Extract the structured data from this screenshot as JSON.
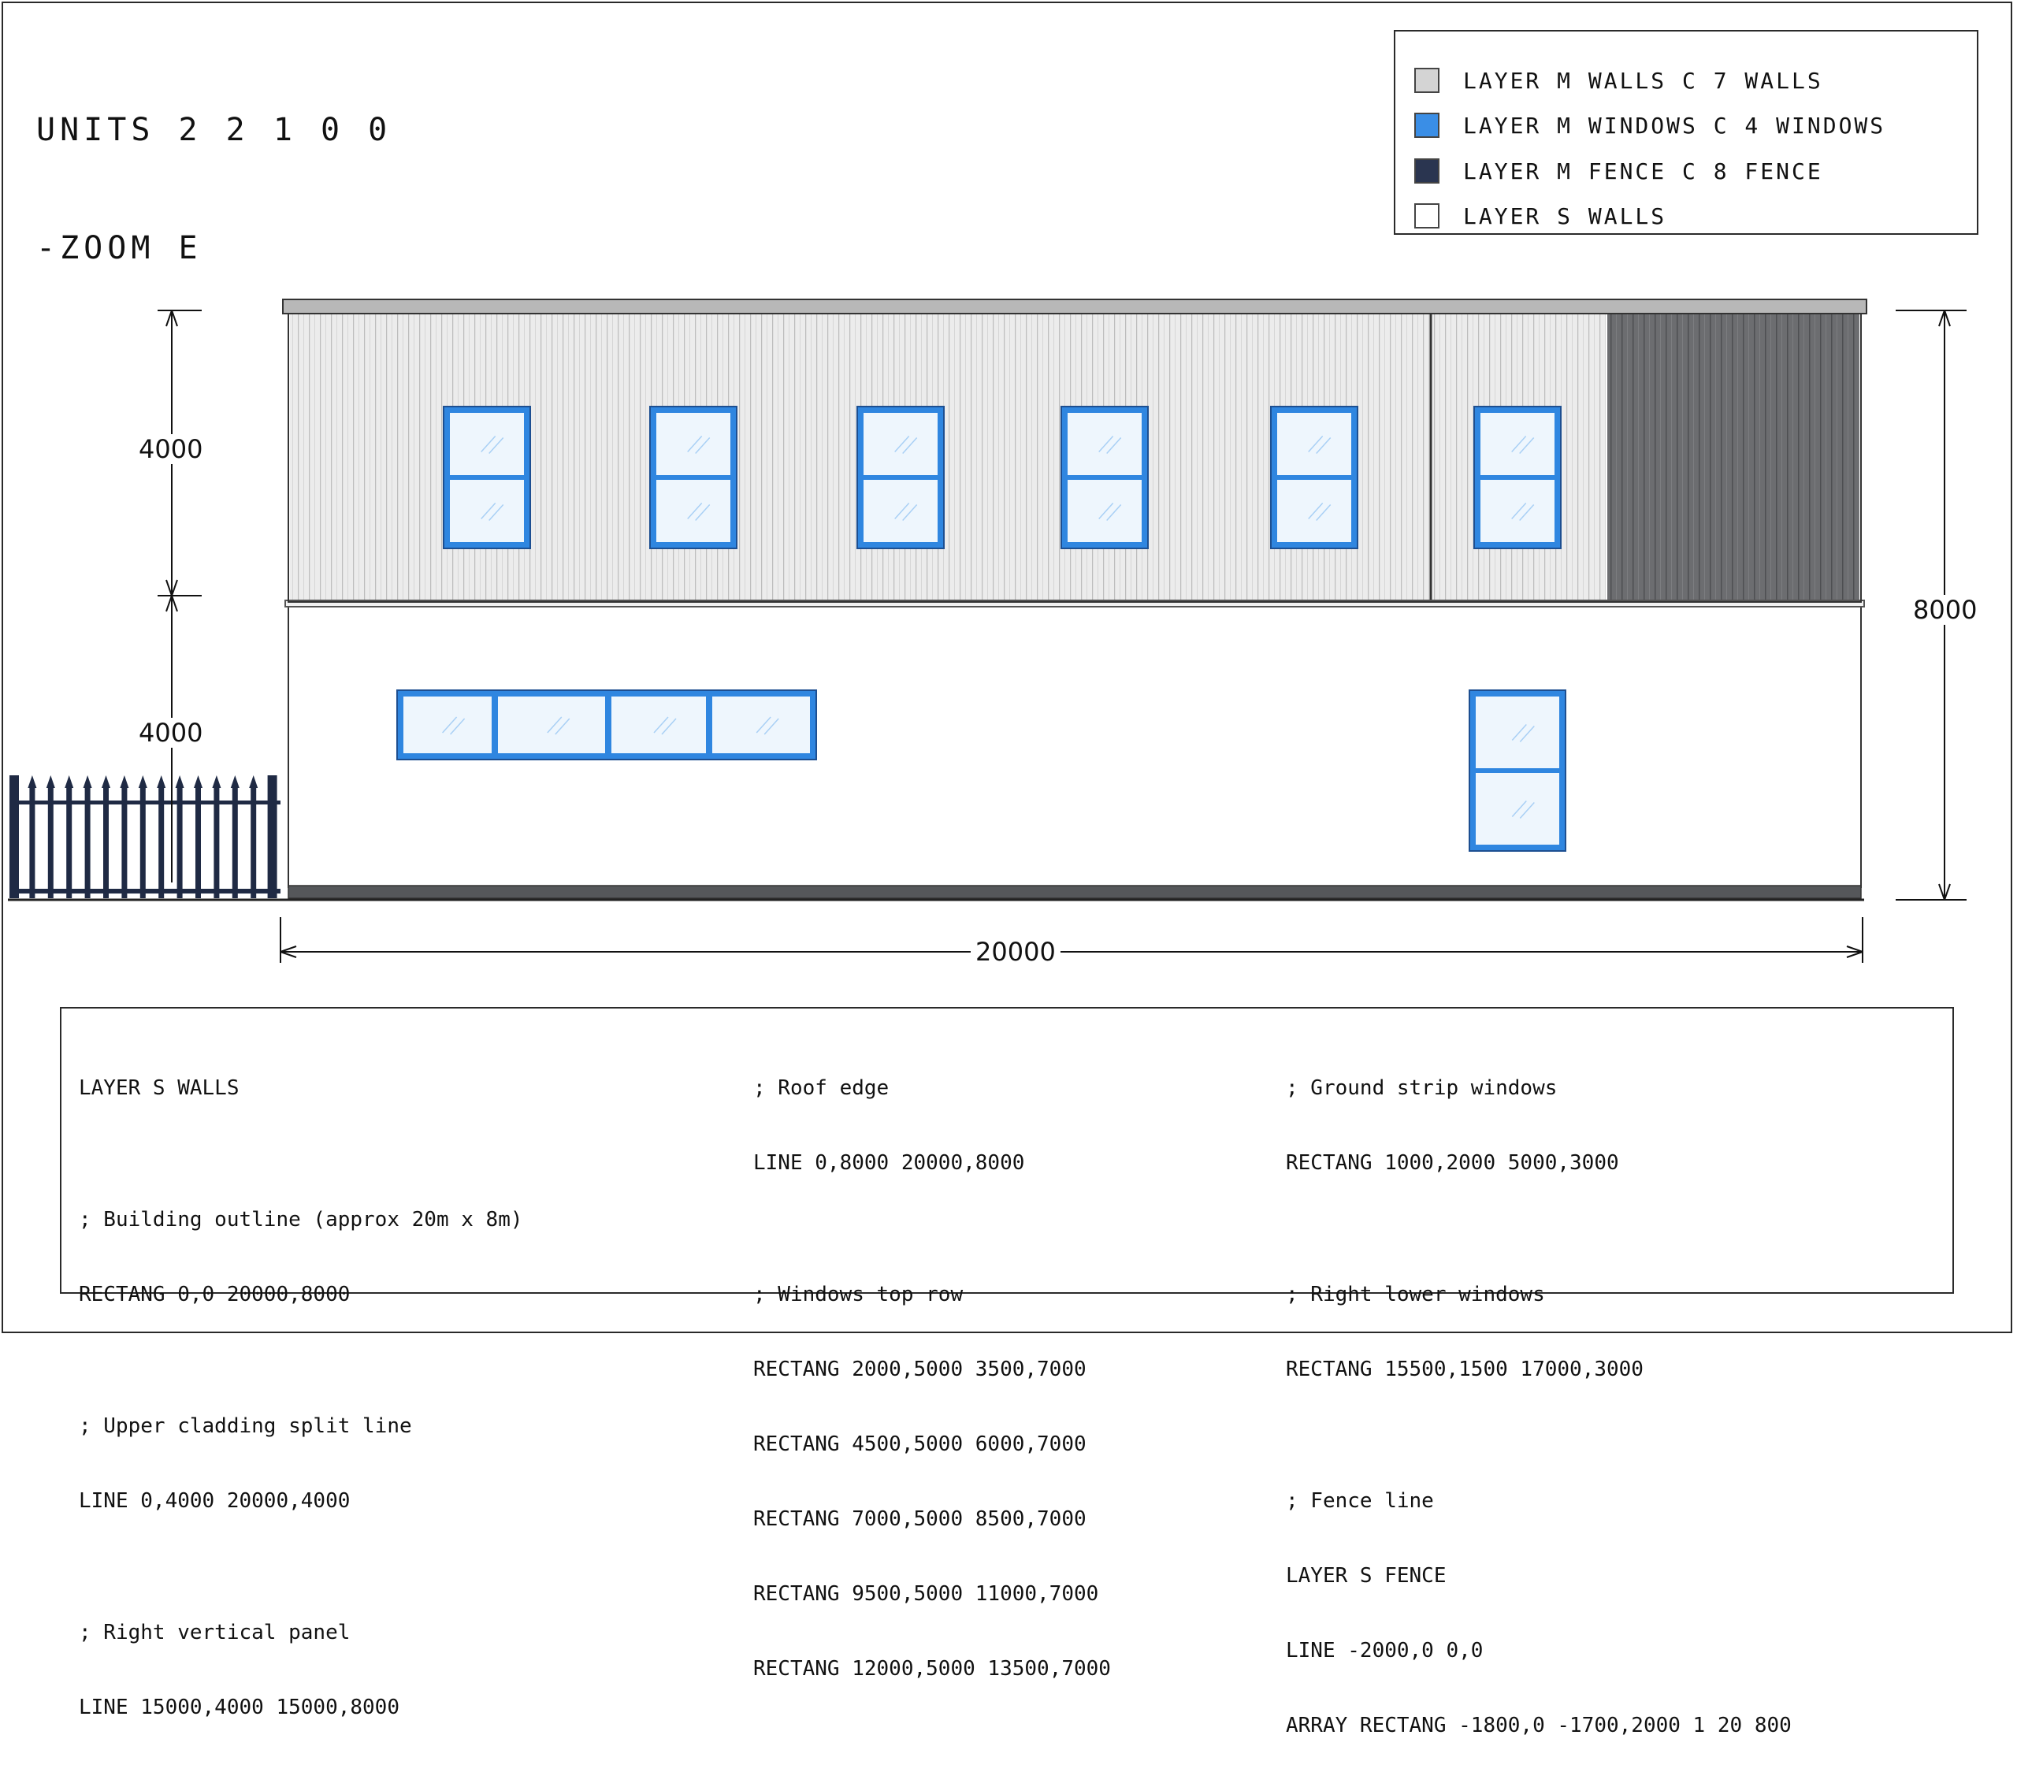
{
  "header": {
    "units_line": "UNITS 2 2 1 0 0",
    "zoom_line": "-ZOOM E"
  },
  "legend": {
    "items": [
      {
        "label": "LAYER M WALLS C 7 WALLS",
        "color": "#d4d4d4"
      },
      {
        "label": "LAYER M WINDOWS C 4 WINDOWS",
        "color": "#3a8ee6"
      },
      {
        "label": "LAYER M FENCE C 8 FENCE",
        "color": "#2a3550"
      },
      {
        "label": "LAYER S WALLS",
        "color": "#ffffff"
      }
    ]
  },
  "dimensions": {
    "upper_height": "4000",
    "lower_height": "4000",
    "total_height": "8000",
    "total_width": "20000"
  },
  "colors": {
    "cladding": "#e6e6e6",
    "dark_panel": "#6d6e71",
    "window_frame": "#2f86e0",
    "window_glass": "#eef6fd",
    "fence": "#1f2a44",
    "roof": "#b8b8b8",
    "base": "#55575a"
  },
  "code_panel": {
    "col1": [
      "LAYER S WALLS",
      "; Building outline (approx 20m x 8m)",
      "RECTANG 0,0 20000,8000",
      "; Upper cladding split line",
      "LINE 0,4000 20000,4000",
      "; Right vertical panel",
      "LINE 15000,4000 15000,8000"
    ],
    "col2": [
      "; Roof edge",
      "LINE 0,8000 20000,8000",
      "; Windows top row",
      "RECTANG 2000,5000 3500,7000",
      "RECTANG 4500,5000 6000,7000",
      "RECTANG 7000,5000 8500,7000",
      "RECTANG 9500,5000 11000,7000",
      "RECTANG 12000,5000 13500,7000"
    ],
    "col3": [
      "; Ground strip windows",
      "RECTANG 1000,2000 5000,3000",
      "; Right lower windows",
      "RECTANG 15500,1500 17000,3000",
      "; Fence line",
      "LAYER S FENCE",
      "LINE -2000,0 0,0",
      "ARRAY RECTANG -1800,0 -1700,2000 1 20 800"
    ]
  }
}
